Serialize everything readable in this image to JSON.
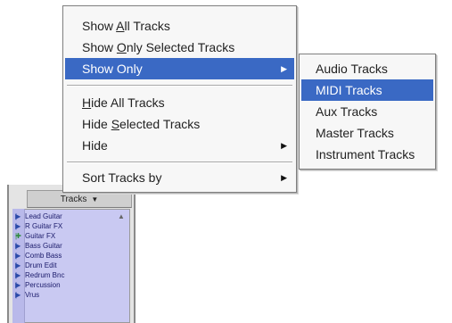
{
  "context_menu": {
    "items": [
      {
        "pre": "Show ",
        "mnemonic": "A",
        "post": "ll Tracks"
      },
      {
        "pre": "Show ",
        "mnemonic": "O",
        "post": "nly Selected Tracks"
      },
      {
        "pre": "Show Only",
        "mnemonic": "",
        "post": ""
      },
      {
        "pre": "",
        "mnemonic": "H",
        "post": "ide All Tracks"
      },
      {
        "pre": "Hide ",
        "mnemonic": "S",
        "post": "elected Tracks"
      },
      {
        "pre": "Hide",
        "mnemonic": "",
        "post": ""
      },
      {
        "pre": "Sort Tracks by",
        "mnemonic": "",
        "post": ""
      }
    ],
    "submenu_arrow": "▶"
  },
  "show_only_submenu": {
    "items": [
      "Audio Tracks",
      "MIDI Tracks",
      "Aux Tracks",
      "Master Tracks",
      "Instrument Tracks"
    ],
    "highlighted": "MIDI Tracks"
  },
  "tracks_panel": {
    "header": "Tracks",
    "header_dropdown_icon": "▼",
    "scroll_up_icon": "▲",
    "tracks": [
      {
        "icon": "|▶",
        "name": "Lead Guitar"
      },
      {
        "icon": "|▶",
        "name": "R Guitar FX"
      },
      {
        "icon": "|✚",
        "name": "Guitar FX"
      },
      {
        "icon": "|▶",
        "name": "Bass Guitar"
      },
      {
        "icon": "|▶",
        "name": "Comb Bass"
      },
      {
        "icon": "|▶",
        "name": "Drum Edit"
      },
      {
        "icon": "|▶",
        "name": "Redrum Bnc"
      },
      {
        "icon": "|▶",
        "name": "Percussion"
      },
      {
        "icon": "|▶",
        "name": "Vrus"
      }
    ]
  },
  "colors": {
    "highlight": "#3a69c4",
    "menu_bg": "#f7f7f7",
    "track_list_bg": "#c9c9f2"
  }
}
